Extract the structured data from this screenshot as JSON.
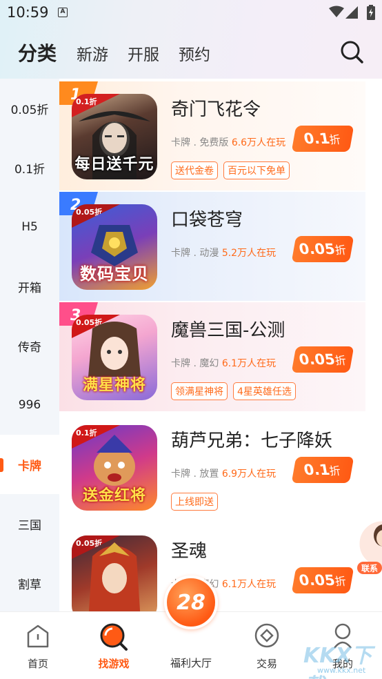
{
  "status": {
    "time": "10:59",
    "notif": "A"
  },
  "top_tabs": [
    "分类",
    "新游",
    "开服",
    "预约"
  ],
  "sidebar": [
    {
      "label": "0.05折"
    },
    {
      "label": "0.1折"
    },
    {
      "label": "H5"
    },
    {
      "label": "开箱"
    },
    {
      "label": "传奇"
    },
    {
      "label": "996"
    },
    {
      "label": "卡牌",
      "active": true
    },
    {
      "label": "三国"
    },
    {
      "label": "割草"
    }
  ],
  "games": [
    {
      "rank": "1",
      "name": "奇门飞花令",
      "meta": "卡牌 . 免费版",
      "online": "6.6万人在玩",
      "discount": "0.1",
      "unit": "折",
      "tags": [
        "送代金卷",
        "百元以下免单"
      ],
      "corner": "0.1折",
      "banner": "每日送千元"
    },
    {
      "rank": "2",
      "name": "口袋苍穹",
      "meta": "卡牌 . 动漫",
      "online": "5.2万人在玩",
      "discount": "0.05",
      "unit": "折",
      "tags": [],
      "corner": "0.05折",
      "banner": "数码宝贝"
    },
    {
      "rank": "3",
      "name": "魔兽三国-公测",
      "meta": "卡牌 . 魔幻",
      "online": "6.1万人在玩",
      "discount": "0.05",
      "unit": "折",
      "tags": [
        "领满星神将",
        "4星英雄任选"
      ],
      "corner": "0.05折",
      "banner": "满星神将"
    },
    {
      "rank": "",
      "name": "葫芦兄弟：七子降妖",
      "meta": "卡牌 . 放置",
      "online": "6.9万人在玩",
      "discount": "0.1",
      "unit": "折",
      "tags": [
        "上线即送"
      ],
      "corner": "0.1折",
      "banner": "送金红将"
    },
    {
      "rank": "",
      "name": "圣魂",
      "meta": "卡牌 . 魔幻",
      "online": "6.1万人在玩",
      "discount": "0.05",
      "unit": "折",
      "tags": [],
      "corner": "0.05折",
      "banner": ""
    }
  ],
  "helper_label": "联系",
  "bottom_nav": {
    "home": "首页",
    "find": "找游戏",
    "center_num": "28",
    "center": "福利大厅",
    "trade": "交易",
    "mine": "我的"
  },
  "watermark": {
    "main": "KKX下载",
    "url": "www.kkx.net"
  },
  "colors": {
    "accent": "#ff5a14",
    "tag": "#ff7a3d"
  }
}
